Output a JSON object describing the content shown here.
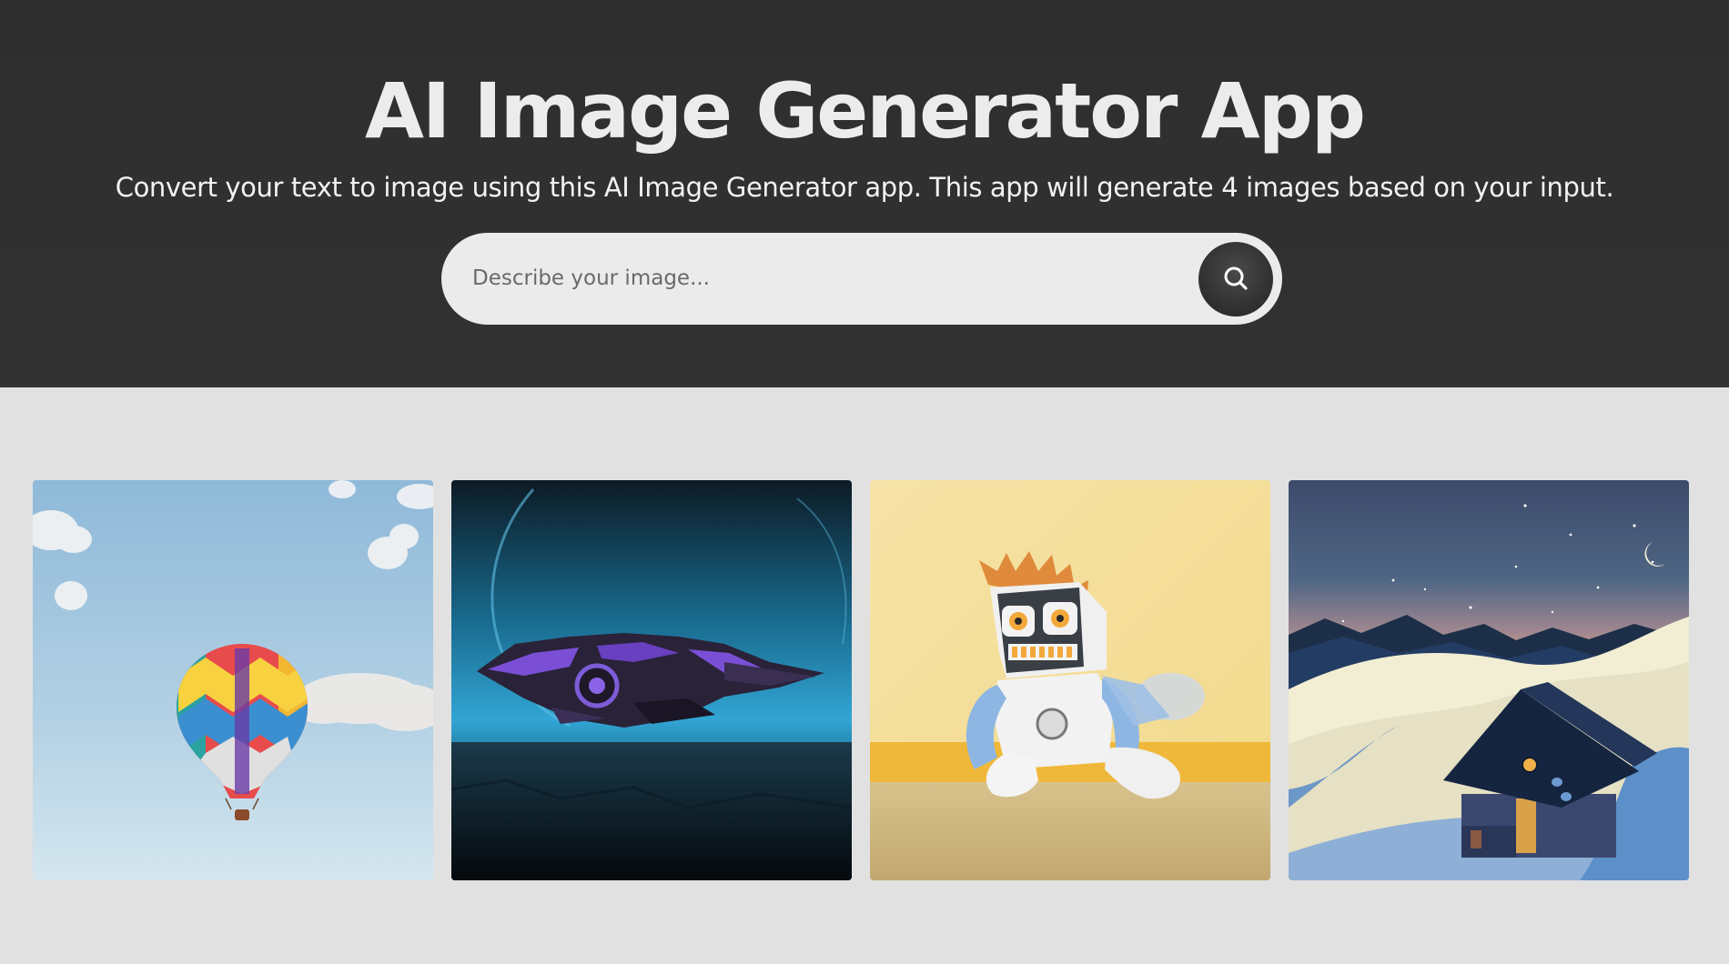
{
  "header": {
    "title": "AI Image Generator App",
    "subtitle": "Convert your text to image using this AI Image Generator app. This app will generate 4 images based on your input."
  },
  "search": {
    "placeholder": "Describe your image...",
    "value": "",
    "button_icon": "search-icon"
  },
  "gallery": {
    "images": [
      {
        "subject": "hot-air-balloon",
        "icon": "image-icon"
      },
      {
        "subject": "spaceship",
        "icon": "image-icon"
      },
      {
        "subject": "robot-plush",
        "icon": "image-icon"
      },
      {
        "subject": "snowy-cabin",
        "icon": "image-icon"
      }
    ]
  },
  "colors": {
    "hero_background": "#2f2f2f",
    "page_background": "#e1e1e1",
    "title_text": "#ececec",
    "search_bar": "#ebebeb",
    "search_button": "#333333"
  }
}
